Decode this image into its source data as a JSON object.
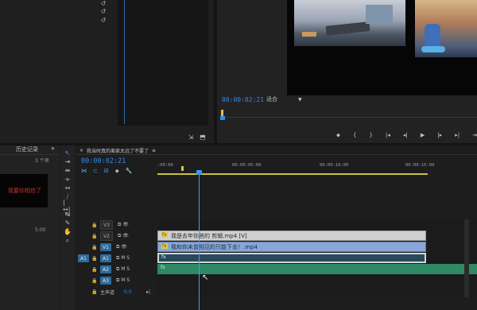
{
  "source_monitor": {
    "icons": [
      "undo-icon",
      "undo-icon",
      "undo-icon"
    ],
    "bottom_icons": [
      "export-frame-icon",
      "export-icon"
    ]
  },
  "program_monitor": {
    "timecode": "00:00:02:21",
    "fit_label": "适合",
    "buttons": [
      "marker-icon",
      "in-point-icon",
      "out-point-icon",
      "go-to-in-icon",
      "step-back-icon",
      "play-icon",
      "step-forward-icon",
      "go-to-out-icon",
      "lift-icon"
    ]
  },
  "history_panel": {
    "tab": "历史记录",
    "more": "»",
    "count": "3 个项",
    "preview_text": "我要你相信了",
    "time": "5:00"
  },
  "timeline": {
    "tab_close": "×",
    "tab_title": "我当时真的离家太远了不要了",
    "tab_menu": "≡",
    "timecode": "00:00:02:21",
    "ruler": [
      ":00:00",
      "00:00:05:00",
      "00:00:10:00",
      "00:00:15:00"
    ],
    "tracks": [
      {
        "label": "V3",
        "target": false,
        "icons": "🔒 ⧉ 👁"
      },
      {
        "label": "V2",
        "target": false,
        "icons": "🔒 ⧉ 👁"
      },
      {
        "label": "V1",
        "target": true,
        "icons": "🔒 ⧉ 👁"
      },
      {
        "label": "A1",
        "target": true,
        "src": "A1",
        "icons": "🔒 ⧉ M S"
      },
      {
        "label": "A2",
        "target": true,
        "icons": "🔒 ⧉ M S"
      },
      {
        "label": "A3",
        "target": true,
        "icons": "🔒 ⧉ M S"
      }
    ],
    "master": {
      "label": "主声道",
      "value": "0.0",
      "end": "▸|"
    },
    "clips": {
      "v2": "我是去年你爸的 剪辑.mp4 [V]",
      "v1": "我和你未曾相见的只能下去！.mp4",
      "a1": "fx",
      "a2": "fx"
    }
  },
  "tools": [
    "selection-tool",
    "track-select-tool",
    "ripple-edit-tool",
    "rolling-edit-tool",
    "rate-stretch-tool",
    "razor-tool",
    "slip-tool",
    "slide-tool",
    "pen-tool",
    "hand-tool",
    "zoom-tool"
  ],
  "colors": {
    "accent": "#2d8ceb",
    "playhead": "#4a9ee8",
    "v2_clip": "#cfcfcf",
    "v1_clip": "#8aa6d6",
    "audio_clip": "#2e8a64"
  }
}
